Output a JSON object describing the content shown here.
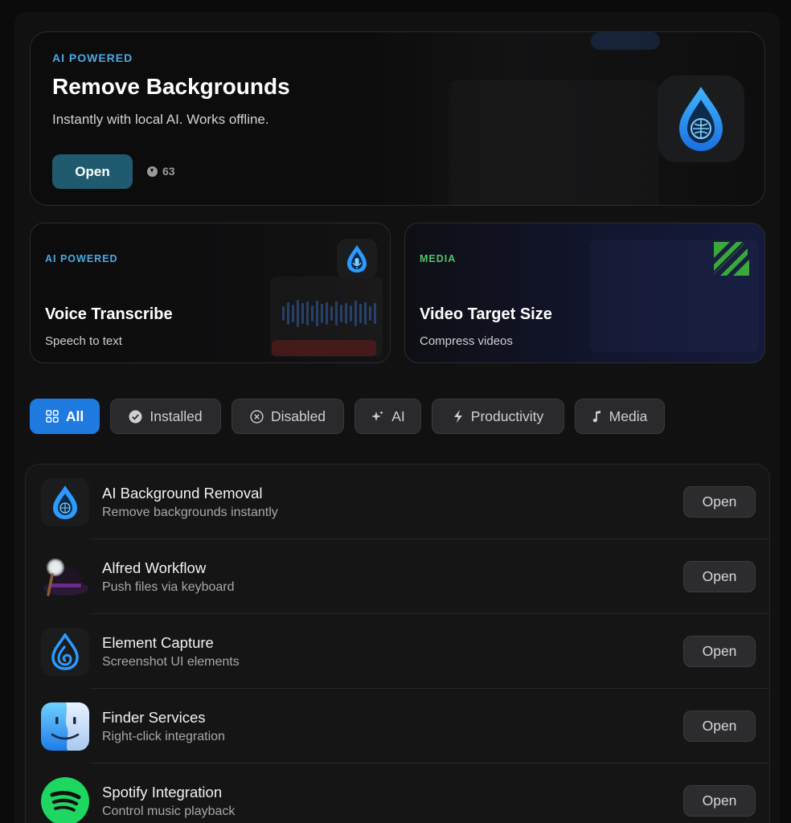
{
  "hero": {
    "eyebrow": "AI POWERED",
    "title": "Remove Backgrounds",
    "subtitle": "Instantly with local AI. Works offline.",
    "open_label": "Open",
    "downloads": "63",
    "icon": "water-drop-brain-icon"
  },
  "cards": [
    {
      "eyebrow": "AI POWERED",
      "title": "Voice Transcribe",
      "subtitle": "Speech to text",
      "icon": "water-drop-mic-icon"
    },
    {
      "eyebrow": "MEDIA",
      "title": "Video Target Size",
      "subtitle": "Compress videos",
      "icon": "ffmpeg-icon"
    }
  ],
  "filters": [
    {
      "label": "All",
      "icon": "grid-icon",
      "active": true
    },
    {
      "label": "Installed",
      "icon": "check-circle-icon",
      "active": false
    },
    {
      "label": "Disabled",
      "icon": "x-circle-icon",
      "active": false
    },
    {
      "label": "AI",
      "icon": "sparkles-icon",
      "active": false
    },
    {
      "label": "Productivity",
      "icon": "bolt-icon",
      "active": false
    },
    {
      "label": "Media",
      "icon": "music-note-icon",
      "active": false
    }
  ],
  "extensions": [
    {
      "name": "AI Background Removal",
      "description": "Remove backgrounds instantly",
      "action": "Open",
      "icon": "water-drop-brain-icon"
    },
    {
      "name": "Alfred Workflow",
      "description": "Push files via keyboard",
      "action": "Open",
      "icon": "alfred-hat-icon"
    },
    {
      "name": "Element Capture",
      "description": "Screenshot UI elements",
      "action": "Open",
      "icon": "water-drop-swirl-icon"
    },
    {
      "name": "Finder Services",
      "description": "Right-click integration",
      "action": "Open",
      "icon": "finder-face-icon"
    },
    {
      "name": "Spotify Integration",
      "description": "Control music playback",
      "action": "Open",
      "icon": "spotify-icon"
    }
  ],
  "colors": {
    "accent": "#1f7ae0",
    "ai_eyebrow": "#4aa9e6",
    "media_eyebrow": "#4fc46a",
    "hero_button": "#1f5a6e"
  }
}
